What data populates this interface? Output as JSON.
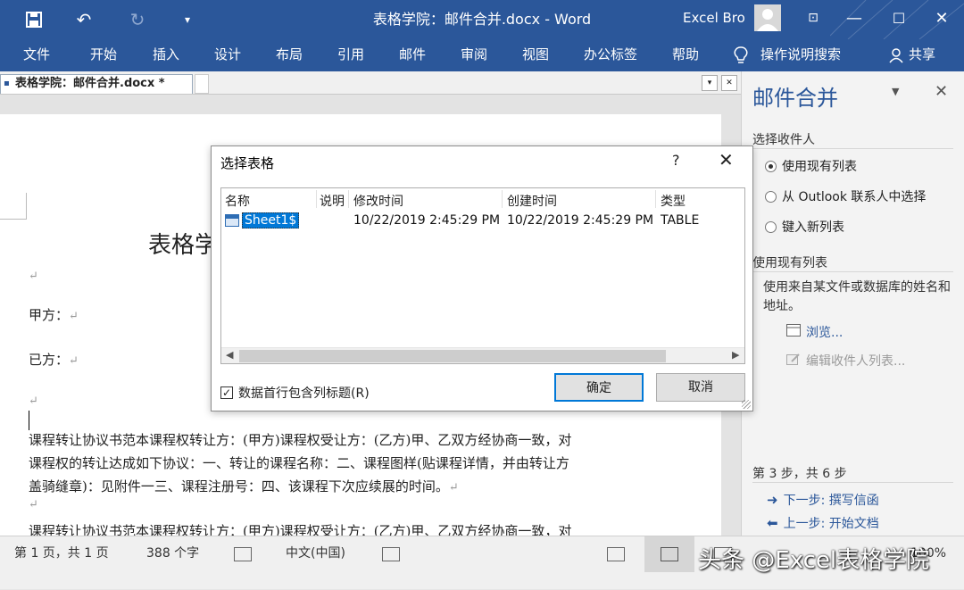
{
  "titlebar": {
    "doc_title": "表格学院：邮件合并.docx  -  Word",
    "user": "Excel Bro"
  },
  "ribbon": {
    "tabs": [
      "文件",
      "开始",
      "插入",
      "设计",
      "布局",
      "引用",
      "邮件",
      "审阅",
      "视图",
      "办公标签",
      "帮助"
    ],
    "tell_me": "操作说明搜索",
    "share": "共享"
  },
  "doctab": {
    "label": "表格学院：邮件合并.docx *"
  },
  "document": {
    "heading": "表格学",
    "party_a": "甲方：",
    "party_b": "已方：",
    "para1_line1": "课程转让协议书范本课程权转让方：(甲方)课程权受让方：(乙方)甲、乙双方经协商一致，对",
    "para1_line2": "课程权的转让达成如下协议：一、转让的课程名称：二、课程图样(贴课程详情，并由转让方",
    "para1_line3": "盖骑缝章)：见附件一三、课程注册号：四、该课程下次应续展的时间。",
    "para2_line1": "课程转让协议书范本课程权转让方：(甲方)课程权受让方：(乙方)甲、乙双方经协商一致，对",
    "para_mark": "↵"
  },
  "pane": {
    "title": "邮件合并",
    "section_recipients": "选择收件人",
    "radio_existing": "使用现有列表",
    "radio_outlook": "从 Outlook 联系人中选择",
    "radio_new": "键入新列表",
    "section_existing": "使用现有列表",
    "desc": "使用来自某文件或数据库的姓名和地址。",
    "browse": "浏览...",
    "edit_list": "编辑收件人列表...",
    "step": "第 3 步，共 6 步",
    "next": "下一步: 撰写信函",
    "prev": "上一步: 开始文档"
  },
  "dialog": {
    "title": "选择表格",
    "help": "?",
    "columns": {
      "name": "名称",
      "desc": "说明",
      "modified": "修改时间",
      "created": "创建时间",
      "type": "类型"
    },
    "rows": [
      {
        "name": "Sheet1$",
        "desc": "",
        "modified": "10/22/2019 2:45:29 PM",
        "created": "10/22/2019 2:45:29 PM",
        "type": "TABLE"
      }
    ],
    "header_checkbox": "数据首行包含列标题(R)",
    "ok": "确定",
    "cancel": "取消"
  },
  "statusbar": {
    "page": "第 1 页，共 1 页",
    "words": "388 个字",
    "language": "中文(中国)",
    "zoom": "100%",
    "watermark": "头条 @Excel表格学院"
  },
  "colors": {
    "accent": "#2b579a",
    "selection": "#0078d7"
  }
}
